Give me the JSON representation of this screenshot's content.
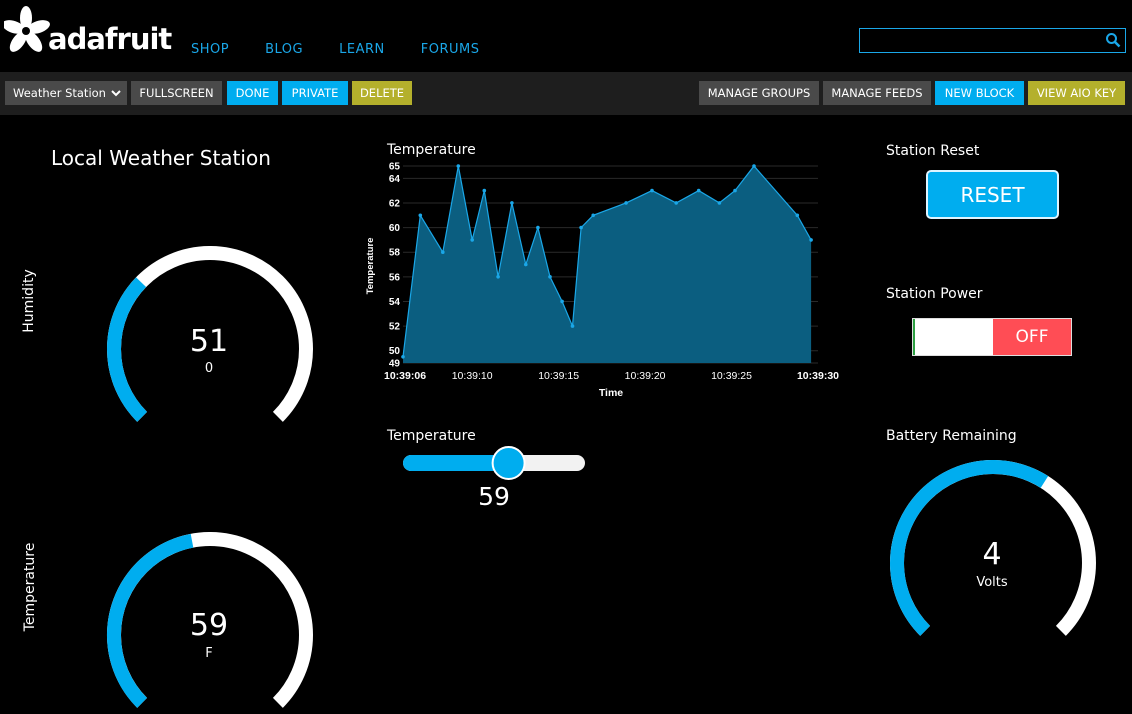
{
  "header": {
    "logo_text": "adafruit",
    "nav": [
      "SHOP",
      "BLOG",
      "LEARN",
      "FORUMS"
    ],
    "search_value": ""
  },
  "toolbar": {
    "dashboard_select": "Weather Station",
    "fullscreen": "FULLSCREEN",
    "done": "DONE",
    "private": "PRIVATE",
    "delete": "DELETE",
    "manage_groups": "MANAGE GROUPS",
    "manage_feeds": "MANAGE FEEDS",
    "new_block": "NEW BLOCK",
    "view_aio_key": "VIEW AIO KEY"
  },
  "colors": {
    "accent_blue": "#00adef",
    "olive": "#b4b02c",
    "off_red": "#ff4d55",
    "chart_fill": "#0b5e80",
    "chart_line": "#1aa7e8"
  },
  "dashboard": {
    "title": "Local Weather Station",
    "humidity": {
      "label": "Humidity",
      "value": "51",
      "unit": "0",
      "fraction": 0.33
    },
    "temperature_gauge": {
      "label": "Temperature",
      "value": "59",
      "unit": "F",
      "fraction": 0.46
    },
    "battery": {
      "label": "Battery Remaining",
      "value": "4",
      "unit": "Volts",
      "fraction": 0.62
    },
    "station_reset": {
      "label": "Station Reset",
      "button": "RESET"
    },
    "station_power": {
      "label": "Station Power",
      "state": "OFF"
    },
    "temperature_slider": {
      "label": "Temperature",
      "value": "59",
      "fraction": 0.59
    }
  },
  "chart_data": {
    "type": "area",
    "title": "Temperature",
    "xlabel": "Time",
    "ylabel": "Temperature",
    "ylim": [
      49,
      65
    ],
    "ytick_values": [
      49,
      50,
      52,
      54,
      56,
      58,
      60,
      62,
      64,
      65
    ],
    "xtick_labels": [
      "10:39:06",
      "10:39:10",
      "10:39:15",
      "10:39:20",
      "10:39:25",
      "10:39:30"
    ],
    "xtick_seconds": [
      6,
      10,
      15,
      20,
      25,
      30
    ],
    "grid": true,
    "series": [
      {
        "x_seconds": [
          6,
          7,
          8.3,
          9.2,
          10.0,
          10.7,
          11.5,
          12.3,
          13.1,
          13.8,
          14.5,
          15.2,
          15.8,
          16.3,
          17.0,
          18.9,
          20.4,
          21.8,
          23.1,
          24.3,
          25.2,
          26.3,
          28.8,
          29.6
        ],
        "y": [
          49.5,
          61,
          58,
          65,
          59,
          63,
          56,
          62,
          57,
          60,
          56,
          54,
          52,
          60,
          61,
          62,
          63,
          62,
          63,
          62,
          63,
          65,
          61,
          59
        ]
      }
    ]
  }
}
